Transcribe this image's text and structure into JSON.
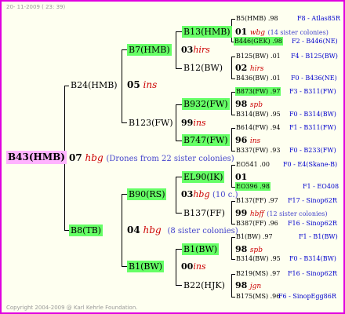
{
  "header": {
    "date": "20- 11-2009 ( 23: 39)"
  },
  "footer": {
    "copyright": "Copyright 2004-2009 @ Karl Kehrle Foundation."
  },
  "root": {
    "name": "B43(HMB)"
  },
  "gen1": {
    "sire": {
      "name": "B24(HMB)",
      "year": "05",
      "line": "ins"
    },
    "mid": {
      "year": "07",
      "line": "hbg",
      "note": "(Drones from 22 sister colonies)"
    },
    "dam": {
      "name": "B8(TB)",
      "year": "04",
      "line": "hbg",
      "note": "(8 sister colonies)"
    }
  },
  "gen2": {
    "b7": {
      "name": "B7(HMB)",
      "year": "03",
      "line": "hirs"
    },
    "b123": {
      "name": "B123(FW)",
      "year": "99",
      "line": "ins"
    },
    "b90": {
      "name": "B90(RS)",
      "year": "03",
      "line": "hbg",
      "note": "(10 c.)"
    },
    "b1": {
      "name": "B1(BW)",
      "year": "00",
      "line": "ins"
    }
  },
  "gen3": {
    "b13": {
      "name": "B13(HMB)",
      "year": "01",
      "line": "wbg",
      "note": "(14 sister colonies)"
    },
    "b12": {
      "name": "B12(BW)",
      "year": "02",
      "line": "hirs"
    },
    "b932": {
      "name": "B932(FW)",
      "year": "98",
      "line": "spb"
    },
    "b747": {
      "name": "B747(FW)",
      "year": "96",
      "line": "ins"
    },
    "el90": {
      "name": "EL90(IK)",
      "year": "01",
      "line": ""
    },
    "b137": {
      "name": "B137(FF)",
      "year": "99",
      "line": "hbff",
      "note": "(12 sister colonies)"
    },
    "b1bw": {
      "name": "B1(BW)",
      "year": "98",
      "line": "spb"
    },
    "b22": {
      "name": "B22(HJK)",
      "year": "98",
      "line": "jgn"
    }
  },
  "gen4": {
    "r0": {
      "name": "B5(HMB)",
      "year": ".98",
      "id": "F8 - Atlas85R"
    },
    "r1": {
      "name": "B446(GEK)",
      "year": ".98",
      "id": "F2 - B446(NE)"
    },
    "r2": {
      "name": "B125(BW)",
      "year": ".01",
      "id": "F4 - B125(BW)"
    },
    "r3": {
      "name": "B436(BW)",
      "year": ".01",
      "id": "F0 - B436(NE)"
    },
    "r4": {
      "name": "B873(FW)",
      "year": ".97",
      "id": "F3 - B311(FW)"
    },
    "r5": {
      "name": "B314(BW)",
      "year": ".95",
      "id": "F0 - B314(BW)"
    },
    "r6": {
      "name": "B614(FW)",
      "year": ".94",
      "id": "F1 - B311(FW)"
    },
    "r7": {
      "name": "B337(FW)",
      "year": ".93",
      "id": "F0 - B233(FW)"
    },
    "r8": {
      "name": "EO541",
      "year": ".00",
      "id": "F0 - E4(Skane-B)"
    },
    "r9": {
      "name": "EO396",
      "year": ".98",
      "id": "F1 - EO408"
    },
    "r10": {
      "name": "B137(FF)",
      "year": ".97",
      "id": "F17 - Sinop62R"
    },
    "r11": {
      "name": "B387(FF)",
      "year": ".96",
      "id": "F16 - Sinop62R"
    },
    "r12": {
      "name": "B1(BW)",
      "year": ".97",
      "id": "F1 - B1(BW)"
    },
    "r13": {
      "name": "B314(BW)",
      "year": ".95",
      "id": "F0 - B314(BW)"
    },
    "r14": {
      "name": "B219(MS)",
      "year": ".97",
      "id": "F16 - Sinop62R"
    },
    "r15": {
      "name": "B175(MS)",
      "year": ".96",
      "id": "F6 - SinopEgg86R"
    }
  }
}
